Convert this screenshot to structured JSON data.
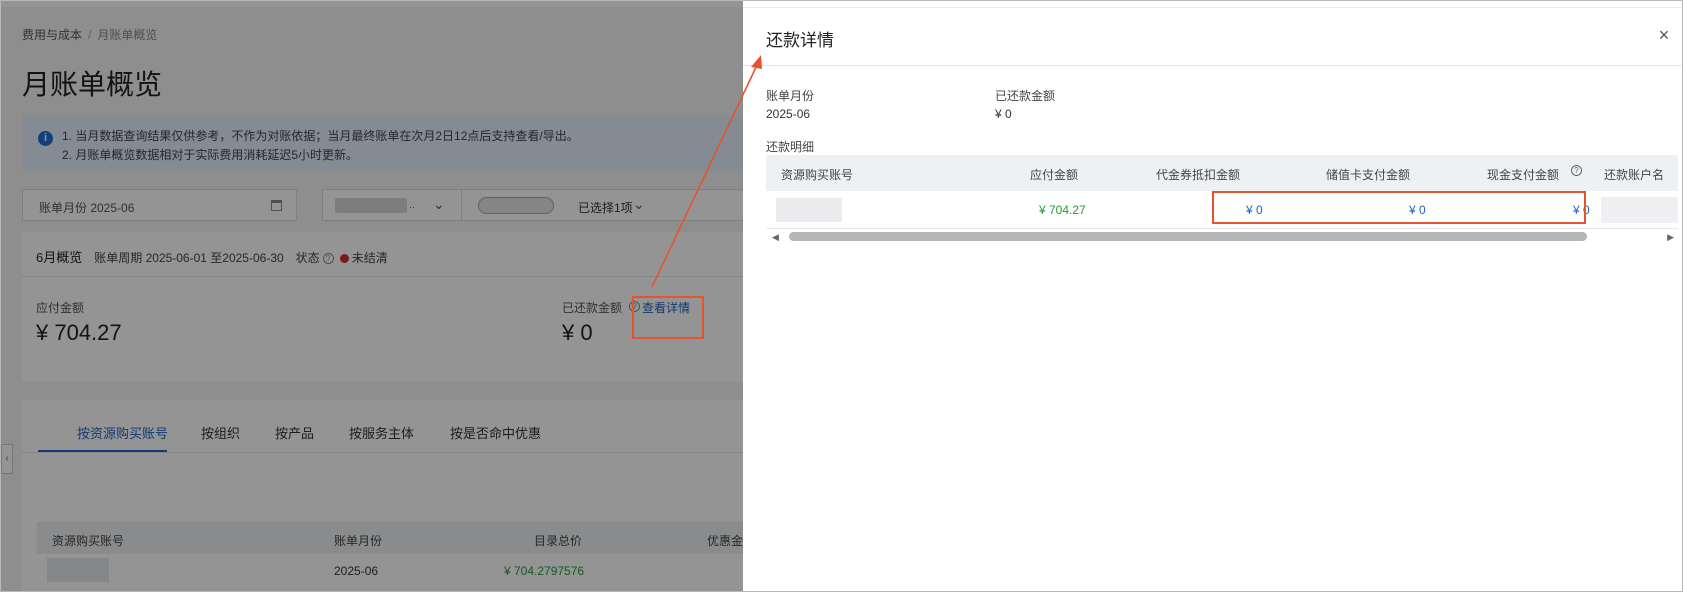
{
  "left_page": {
    "breadcrumb": [
      "费用与成本",
      "月账单概览"
    ],
    "breadcrumb_sep": "/",
    "title": "月账单概览",
    "notice": {
      "icon": "info-icon",
      "line1": "1. 当月数据查询结果仅供参考，不作为对账依据；当月最终账单在次月2日12点后支持查看/导出。",
      "line2": "2. 月账单概览数据相对于实际费用消耗延迟5小时更新。"
    },
    "filters": {
      "month_label": "账单月份 2025-06",
      "account_ellipsis": "..",
      "selected_count": "已选择1项"
    },
    "summary": {
      "month": "6月概览",
      "period": "账单周期 2025-06-01 至2025-06-30",
      "status_label": "状态",
      "status_value": "未结清",
      "due_label": "应付金额",
      "due_value": "¥ 704.27",
      "paid_label": "已还款金额",
      "paid_value": "¥ 0",
      "view_detail": "查看详情"
    },
    "tabs": [
      "按资源购买账号",
      "按组织",
      "按产品",
      "按服务主体",
      "按是否命中优惠"
    ],
    "bill_table": {
      "headers": [
        "资源购买账号",
        "账单月份",
        "目录总价",
        "优惠金"
      ],
      "row": {
        "month": "2025-06",
        "list_price": "¥ 704.2797576"
      }
    }
  },
  "drawer": {
    "title": "还款详情",
    "close": "×",
    "bill_month_label": "账单月份",
    "bill_month_value": "2025-06",
    "repaid_label": "已还款金额",
    "repaid_value": "¥ 0",
    "section_label": "还款明细",
    "table": {
      "headers": [
        "资源购买账号",
        "应付金额",
        "代金券抵扣金额",
        "储值卡支付金额",
        "现金支付金额",
        "还款账户名"
      ],
      "row": {
        "due": "¥ 704.27",
        "voucher": "¥ 0",
        "stored_card": "¥ 0",
        "cash": "¥ 0"
      }
    }
  },
  "colors": {
    "accent": "#1f62c6",
    "positive": "#1f9d3a",
    "annotation": "#e3542f",
    "status_red": "#d43030"
  }
}
